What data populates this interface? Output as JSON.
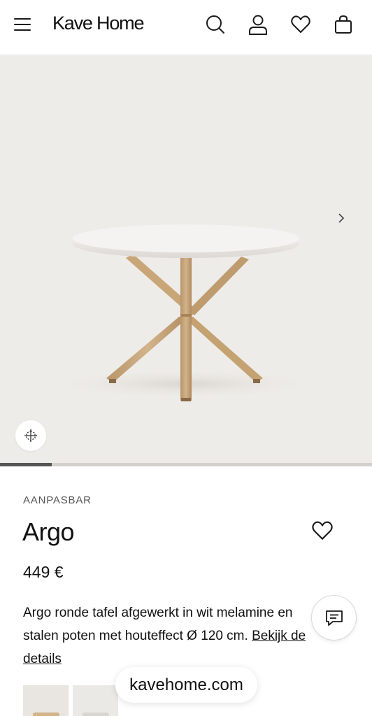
{
  "header": {
    "logo": "Kave Home",
    "icons": [
      "menu-icon",
      "search-icon",
      "user-icon",
      "heart-icon",
      "bag-icon"
    ]
  },
  "gallery": {
    "progress": 0.14,
    "icons": [
      "chevron-right-icon",
      "ar-view-icon"
    ],
    "colors": {
      "background": "#eeece8",
      "tabletop": "#f4f2f0",
      "legs": "#c7a87a"
    }
  },
  "product": {
    "eyebrow": "AANPASBAR",
    "name": "Argo",
    "price": "449 €",
    "description": "Argo ronde tafel afgewerkt in wit melamine en stalen poten met houteffect Ø 120 cm.",
    "details_link": "Bekijk de details"
  },
  "chat": {
    "icon": "chat-icon"
  },
  "browser": {
    "url": "kavehome.com"
  }
}
